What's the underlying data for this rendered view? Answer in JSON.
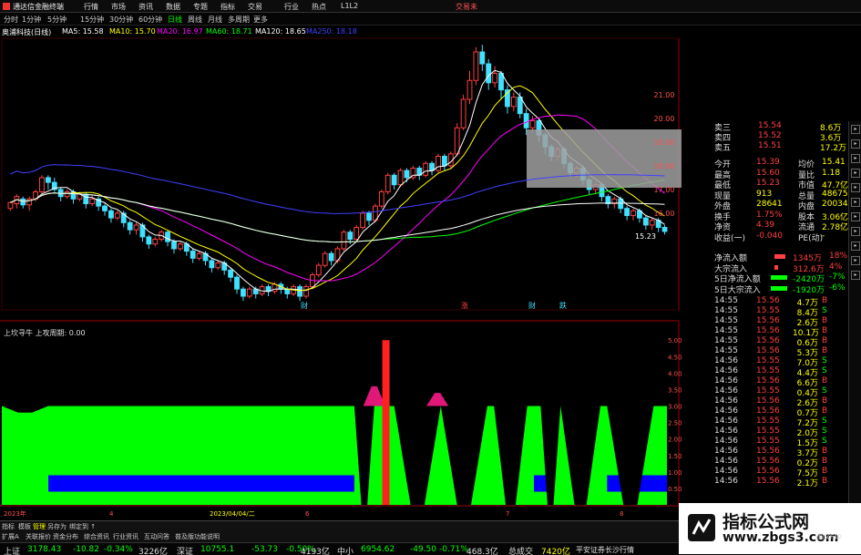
{
  "menubar": {
    "app_title": "通达信金融终端",
    "items": [
      "行情",
      "市场",
      "资讯",
      "数据",
      "专题",
      "指标",
      "交易",
      "行业",
      "热点",
      "L1L2"
    ],
    "trade_label": "交易未"
  },
  "periodbar": {
    "periods": [
      "分时",
      "1分钟",
      "5分钟",
      "15分钟",
      "30分钟",
      "60分钟",
      "日线",
      "周线",
      "月线",
      "多周期",
      "更多"
    ],
    "selected": "日线"
  },
  "ma_line": {
    "stock": "奥浦科技(日线)",
    "ma5": "MA5: 15.58",
    "ma10": "MA10: 15.70",
    "ma20": "MA20: 16.97",
    "ma60": "MA60: 18.71",
    "ma120": "MA120: 18.65",
    "ma250": "MA250: 18.18",
    "colors": {
      "ma5": "#ffffff",
      "ma10": "#ffff00",
      "ma20": "#ff00ff",
      "ma60": "#00ff00",
      "ma120": "#ffffff",
      "ma250": "#4040ff"
    }
  },
  "main_chart": {
    "price_axis": [
      {
        "label": "21.00",
        "price": 21.0
      },
      {
        "label": "20.00",
        "price": 20.0
      },
      {
        "label": "19.00",
        "price": 19.0
      },
      {
        "label": "18.00",
        "price": 18.0
      },
      {
        "label": "17.00",
        "price": 17.0
      },
      {
        "label": "16.00",
        "price": 16.0
      }
    ],
    "last_price_label": "15.23",
    "markers": [
      "财",
      "涨",
      "财",
      "跌"
    ],
    "candles": [
      [
        16.2,
        16.45,
        16.1,
        16.5
      ],
      [
        16.4,
        16.7,
        16.2,
        16.8
      ],
      [
        16.6,
        16.35,
        16.2,
        16.7
      ],
      [
        16.35,
        16.6,
        16.1,
        16.7
      ],
      [
        16.6,
        16.9,
        16.5,
        17.0
      ],
      [
        16.9,
        17.5,
        16.8,
        17.6
      ],
      [
        17.5,
        17.3,
        17.0,
        17.6
      ],
      [
        17.3,
        17.0,
        16.9,
        17.5
      ],
      [
        17.0,
        16.7,
        16.5,
        17.1
      ],
      [
        16.7,
        16.9,
        16.6,
        17.0
      ],
      [
        16.9,
        16.6,
        16.4,
        17.0
      ],
      [
        16.6,
        16.8,
        16.5,
        16.9
      ],
      [
        16.8,
        16.4,
        16.2,
        16.9
      ],
      [
        16.4,
        16.6,
        16.3,
        16.8
      ],
      [
        16.6,
        16.3,
        16.1,
        16.7
      ],
      [
        16.3,
        16.1,
        15.9,
        16.4
      ],
      [
        16.1,
        15.8,
        15.6,
        16.2
      ],
      [
        15.8,
        16.0,
        15.7,
        16.1
      ],
      [
        16.0,
        15.6,
        15.4,
        16.1
      ],
      [
        15.6,
        15.3,
        15.1,
        15.7
      ],
      [
        15.3,
        15.5,
        15.1,
        15.6
      ],
      [
        15.5,
        15.0,
        14.8,
        15.6
      ],
      [
        15.0,
        14.7,
        14.5,
        15.1
      ],
      [
        14.7,
        14.9,
        14.6,
        15.0
      ],
      [
        14.9,
        15.2,
        14.8,
        15.3
      ],
      [
        15.2,
        14.8,
        14.6,
        15.3
      ],
      [
        14.8,
        14.5,
        14.3,
        14.9
      ],
      [
        14.5,
        14.7,
        14.4,
        14.8
      ],
      [
        14.7,
        14.4,
        14.2,
        14.8
      ],
      [
        14.4,
        14.1,
        13.9,
        14.5
      ],
      [
        14.1,
        14.3,
        14.0,
        14.4
      ],
      [
        14.3,
        14.0,
        13.8,
        14.4
      ],
      [
        14.0,
        13.7,
        13.5,
        14.1
      ],
      [
        13.7,
        13.9,
        13.6,
        14.0
      ],
      [
        13.9,
        13.6,
        13.4,
        14.0
      ],
      [
        13.6,
        13.3,
        13.1,
        13.7
      ],
      [
        13.3,
        12.8,
        12.6,
        13.4
      ],
      [
        12.8,
        12.5,
        12.3,
        12.9
      ],
      [
        12.5,
        12.8,
        12.4,
        12.9
      ],
      [
        12.8,
        12.6,
        12.4,
        12.9
      ],
      [
        12.6,
        12.9,
        12.5,
        13.0
      ],
      [
        12.9,
        12.7,
        12.5,
        13.0
      ],
      [
        12.7,
        13.0,
        12.6,
        13.1
      ],
      [
        13.0,
        12.8,
        12.6,
        13.1
      ],
      [
        12.8,
        12.6,
        12.4,
        12.9
      ],
      [
        12.6,
        12.9,
        12.5,
        13.0
      ],
      [
        12.9,
        12.5,
        12.3,
        13.0
      ],
      [
        12.5,
        12.9,
        12.4,
        13.0
      ],
      [
        12.9,
        13.4,
        12.8,
        13.5
      ],
      [
        13.4,
        13.8,
        13.3,
        13.9
      ],
      [
        13.8,
        14.3,
        13.7,
        14.4
      ],
      [
        14.3,
        14.0,
        13.8,
        14.4
      ],
      [
        14.0,
        14.5,
        13.9,
        14.6
      ],
      [
        14.5,
        15.2,
        14.4,
        15.3
      ],
      [
        15.2,
        14.9,
        14.7,
        15.3
      ],
      [
        14.9,
        15.4,
        14.8,
        15.5
      ],
      [
        15.4,
        16.0,
        15.3,
        16.1
      ],
      [
        16.0,
        15.7,
        15.5,
        16.1
      ],
      [
        15.7,
        16.3,
        15.6,
        16.4
      ],
      [
        16.3,
        16.9,
        16.2,
        17.0
      ],
      [
        16.9,
        17.6,
        16.8,
        17.7
      ],
      [
        17.6,
        17.2,
        17.0,
        17.7
      ],
      [
        17.2,
        17.8,
        17.1,
        17.9
      ],
      [
        17.8,
        17.5,
        17.3,
        17.9
      ],
      [
        17.5,
        17.9,
        17.4,
        18.0
      ],
      [
        17.9,
        17.6,
        17.4,
        18.0
      ],
      [
        17.6,
        18.1,
        17.5,
        18.2
      ],
      [
        18.1,
        17.8,
        17.6,
        18.2
      ],
      [
        17.8,
        18.4,
        17.7,
        18.5
      ],
      [
        18.4,
        18.0,
        17.8,
        18.5
      ],
      [
        18.0,
        18.5,
        17.9,
        18.6
      ],
      [
        18.5,
        19.6,
        18.4,
        19.8
      ],
      [
        19.6,
        20.8,
        19.5,
        21.0
      ],
      [
        20.8,
        21.6,
        20.6,
        22.0
      ],
      [
        21.6,
        22.8,
        21.4,
        23.0
      ],
      [
        22.8,
        22.3,
        22.0,
        23.1
      ],
      [
        22.3,
        21.5,
        21.2,
        22.5
      ],
      [
        21.5,
        21.9,
        21.3,
        22.2
      ],
      [
        21.9,
        21.2,
        20.8,
        22.0
      ],
      [
        21.2,
        20.5,
        20.2,
        21.4
      ],
      [
        20.5,
        20.9,
        20.3,
        21.1
      ],
      [
        20.9,
        20.2,
        20.0,
        21.1
      ],
      [
        20.2,
        19.6,
        19.3,
        20.4
      ],
      [
        19.6,
        19.9,
        19.4,
        20.1
      ],
      [
        19.9,
        19.3,
        19.0,
        20.0
      ],
      [
        19.3,
        18.8,
        18.5,
        19.4
      ],
      [
        18.8,
        18.4,
        18.2,
        18.9
      ],
      [
        18.4,
        18.7,
        18.2,
        18.8
      ],
      [
        18.7,
        18.1,
        17.9,
        18.8
      ],
      [
        18.1,
        17.7,
        17.5,
        18.2
      ],
      [
        17.7,
        17.9,
        17.5,
        18.0
      ],
      [
        17.9,
        17.4,
        17.2,
        18.0
      ],
      [
        17.4,
        17.0,
        16.8,
        17.5
      ],
      [
        17.0,
        17.2,
        16.8,
        17.3
      ],
      [
        17.2,
        16.7,
        16.5,
        17.3
      ],
      [
        16.7,
        16.4,
        16.2,
        16.8
      ],
      [
        16.4,
        16.6,
        16.2,
        16.7
      ],
      [
        16.6,
        16.2,
        16.0,
        16.7
      ],
      [
        16.2,
        15.9,
        15.7,
        16.3
      ],
      [
        15.9,
        16.1,
        15.7,
        16.2
      ],
      [
        16.1,
        15.8,
        15.6,
        16.2
      ],
      [
        15.8,
        15.5,
        15.3,
        15.9
      ],
      [
        15.5,
        15.7,
        15.3,
        15.8
      ],
      [
        15.7,
        15.4,
        15.2,
        15.8
      ],
      [
        15.4,
        15.23,
        15.1,
        15.5
      ]
    ],
    "gray_box_note": ""
  },
  "indicator": {
    "title": "上坎寻牛  上攻周期: 0.00",
    "scale": [
      "5.00",
      "4.50",
      "4.00",
      "3.50",
      "3.00",
      "2.50",
      "2.00",
      "1.50",
      "1.00",
      "0.50"
    ],
    "x_labels": [
      "2023年",
      "4",
      "2023/04/04/二",
      "6",
      "7",
      "8"
    ],
    "green_level": 3.0,
    "blue_level": 0.9,
    "pink_peaks": [
      3.6,
      3.4
    ],
    "red_bar_peak": 5.0,
    "dips": [
      {
        "start": 0.0,
        "end": 0.07,
        "depth": 2.8
      },
      {
        "start": 0.53,
        "end": 0.56,
        "depth": 0.0
      },
      {
        "start": 0.59,
        "end": 0.66,
        "depth": 0.0
      },
      {
        "start": 0.66,
        "end": 0.73,
        "depth": 0.0
      },
      {
        "start": 0.74,
        "end": 0.79,
        "depth": 0.0
      },
      {
        "start": 0.81,
        "end": 0.84,
        "depth": 0.0
      },
      {
        "start": 0.84,
        "end": 0.9,
        "depth": 0.0
      },
      {
        "start": 0.91,
        "end": 0.98,
        "depth": 0.0
      }
    ]
  },
  "right_panel": {
    "quotes": [
      {
        "label": "卖三",
        "price": "15.54",
        "vol": "8.6万"
      },
      {
        "label": "卖四",
        "price": "15.52",
        "vol": "3.6万"
      },
      {
        "label": "卖五",
        "price": "15.51",
        "vol": "17.2万"
      }
    ],
    "stats": [
      {
        "a": "今开",
        "b": "15.39",
        "c": "均价",
        "d": "15.41"
      },
      {
        "a": "最高",
        "b": "15.60",
        "c": "量比",
        "d": "1.18"
      },
      {
        "a": "最低",
        "b": "15.23",
        "c": "市值",
        "d": "47.7亿"
      },
      {
        "a": "现量",
        "b": "913",
        "c": "总量",
        "d": "48675"
      },
      {
        "a": "外盘",
        "b": "28641",
        "c": "内盘",
        "d": "20034"
      },
      {
        "a": "换手",
        "b": "1.75%",
        "c": "股本",
        "d": "3.06亿"
      },
      {
        "a": "净资",
        "b": "4.39",
        "c": "流通",
        "d": "2.78亿"
      },
      {
        "a": "收益(一)",
        "b": "-0.040",
        "c": "PE(动)",
        "d": "-"
      }
    ],
    "flows": [
      {
        "label": "净流入额",
        "value": "1345万",
        "pct": "18%"
      },
      {
        "label": "大宗流入",
        "value": "312.6万",
        "pct": "4%"
      },
      {
        "label": "5日净流入额",
        "value": "-2420万",
        "pct": "-7%"
      },
      {
        "label": "5日大宗流入",
        "value": "-1920万",
        "pct": "-6%"
      }
    ],
    "trades": [
      {
        "t": "14:55",
        "p": "15.56",
        "v": "4.7万",
        "s": "B"
      },
      {
        "t": "14:55",
        "p": "15.55",
        "v": "8.4万",
        "s": "S"
      },
      {
        "t": "14:55",
        "p": "15.56",
        "v": "2.6万",
        "s": "B"
      },
      {
        "t": "14:55",
        "p": "15.56",
        "v": "10.1万",
        "s": "B"
      },
      {
        "t": "14:55",
        "p": "15.56",
        "v": "0.6万",
        "s": "B"
      },
      {
        "t": "14:55",
        "p": "15.56",
        "v": "5.3万",
        "s": "B"
      },
      {
        "t": "14:56",
        "p": "15.55",
        "v": "7.0万",
        "s": "S"
      },
      {
        "t": "14:56",
        "p": "15.55",
        "v": "4.4万",
        "s": "S"
      },
      {
        "t": "14:56",
        "p": "15.56",
        "v": "6.6万",
        "s": "B"
      },
      {
        "t": "14:56",
        "p": "15.55",
        "v": "0.4万",
        "s": "S"
      },
      {
        "t": "14:56",
        "p": "15.56",
        "v": "2.6万",
        "s": "B"
      },
      {
        "t": "14:56",
        "p": "15.56",
        "v": "0.7万",
        "s": "B"
      },
      {
        "t": "14:56",
        "p": "15.55",
        "v": "7.2万",
        "s": "S"
      },
      {
        "t": "14:56",
        "p": "15.55",
        "v": "2.0万",
        "s": "S"
      },
      {
        "t": "14:56",
        "p": "15.55",
        "v": "1.5万",
        "s": "S"
      },
      {
        "t": "14:56",
        "p": "15.56",
        "v": "3.7万",
        "s": "B"
      },
      {
        "t": "14:56",
        "p": "15.56",
        "v": "0.2万",
        "s": "B"
      },
      {
        "t": "14:56",
        "p": "15.56",
        "v": "7.5万",
        "s": "B"
      },
      {
        "t": "14:56",
        "p": "15.56",
        "v": "2.1万",
        "s": "B"
      }
    ]
  },
  "tabs": {
    "items": [
      "指标",
      "模板",
      "管理",
      "另存为",
      "绑定到 ↑",
      "扩展A",
      "关联报价",
      "资金分布",
      "综合资讯",
      "行业资讯",
      "互动问答",
      "普及版功能说明"
    ],
    "active": "管理"
  },
  "ticker": {
    "sh_label": "上证",
    "sh_val": "3178.43",
    "sh_chg": "-10.82",
    "sh_pct": "-0.34%",
    "sh_amt": "3226亿",
    "sz_label": "深证",
    "sz_val": "10755.1",
    "sz_chg": "-53.73",
    "sz_pct": "-0.50%",
    "sz_amt": "4193亿",
    "zx_label": "中小",
    "zx_val": "6954.62",
    "zx_chg": "-49.50",
    "zx_pct": "-0.71%",
    "zx_amt": "468.3亿",
    "total_label": "总成交",
    "total_val": "7420亿",
    "broker": "平安证券长沙行情"
  },
  "watermark": {
    "brand": "指标公式网",
    "url": "www.zbgs3.com",
    "right_label": "图文F10"
  }
}
